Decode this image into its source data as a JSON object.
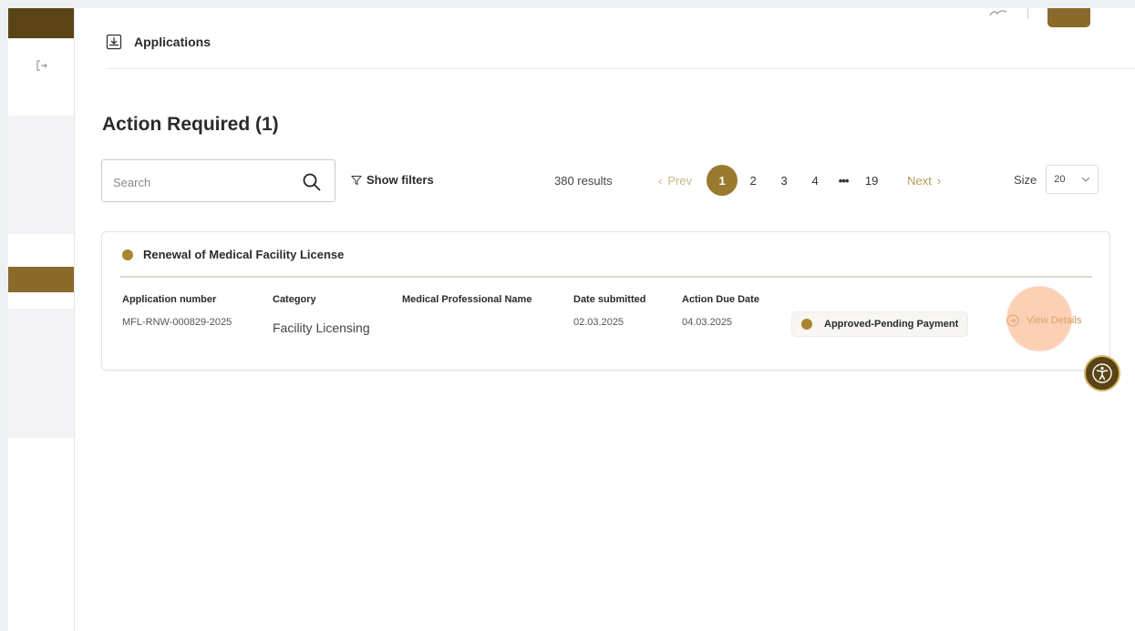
{
  "header": {
    "title": "Applications"
  },
  "page": {
    "title": "Action Required (1)"
  },
  "search": {
    "placeholder": "Search"
  },
  "filters": {
    "label": "Show filters"
  },
  "pagination": {
    "results": "380 results",
    "prev": "Prev",
    "next": "Next",
    "pages": [
      "1",
      "2",
      "3",
      "4"
    ],
    "ellipsis": "•••",
    "last": "19",
    "current": "1",
    "size_label": "Size",
    "size_value": "20"
  },
  "application": {
    "title": "Renewal of Medical Facility License",
    "columns": {
      "number": "Application number",
      "category": "Category",
      "professional": "Medical Professional Name",
      "submitted": "Date submitted",
      "due": "Action Due Date"
    },
    "values": {
      "number": "MFL-RNW-000829-2025",
      "category": "Facility Licensing",
      "professional": "",
      "submitted": "02.03.2025",
      "due": "04.03.2025"
    },
    "status": "Approved-Pending Payment",
    "action": "View Details"
  },
  "colors": {
    "brand_dark": "#5a4416",
    "brand_gold": "#9a7a2e",
    "status_dot": "#a8852f",
    "link": "#b89a55"
  },
  "icons": {
    "header": "download-tray-icon",
    "search": "search-icon",
    "filter": "filter-funnel-icon",
    "logout": "logout-icon",
    "view_details": "arrow-circle-icon",
    "accessibility": "accessibility-icon"
  }
}
